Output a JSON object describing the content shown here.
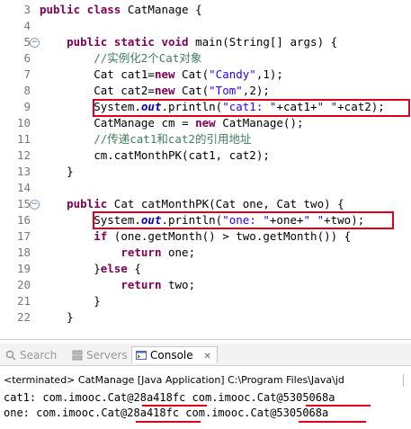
{
  "editor": {
    "lines": [
      {
        "n": "3",
        "parts": [
          [
            "kw",
            "public class "
          ],
          [
            "",
            "CatManage {"
          ]
        ]
      },
      {
        "n": "4",
        "parts": []
      },
      {
        "n": "5",
        "fold": true,
        "parts": [
          [
            "",
            "    "
          ],
          [
            "kw",
            "public static void "
          ],
          [
            "",
            "main(String[] args) {"
          ]
        ]
      },
      {
        "n": "6",
        "parts": [
          [
            "cmt",
            "        //实例化2个Cat对象"
          ]
        ]
      },
      {
        "n": "7",
        "parts": [
          [
            "",
            "        Cat cat1="
          ],
          [
            "kw",
            "new "
          ],
          [
            "",
            "Cat("
          ],
          [
            "str",
            "\"Candy\""
          ],
          [
            "",
            ",1);"
          ]
        ]
      },
      {
        "n": "8",
        "parts": [
          [
            "",
            "        Cat cat2="
          ],
          [
            "kw",
            "new "
          ],
          [
            "",
            "Cat("
          ],
          [
            "str",
            "\"Tom\""
          ],
          [
            "",
            ",2);"
          ]
        ]
      },
      {
        "n": "9",
        "parts": [
          [
            "",
            "        System."
          ],
          [
            "fld",
            "out"
          ],
          [
            "",
            ".println("
          ],
          [
            "str",
            "\"cat1: \""
          ],
          [
            "",
            "+cat1+"
          ],
          [
            "str",
            "\" \""
          ],
          [
            "",
            "+cat2);"
          ]
        ]
      },
      {
        "n": "10",
        "parts": [
          [
            "",
            "        CatManage cm = "
          ],
          [
            "kw",
            "new "
          ],
          [
            "",
            "CatManage();"
          ]
        ]
      },
      {
        "n": "11",
        "parts": [
          [
            "cmt",
            "        //传递cat1和cat2的引用地址"
          ]
        ]
      },
      {
        "n": "12",
        "parts": [
          [
            "",
            "        cm.catMonthPK(cat1, cat2);"
          ]
        ]
      },
      {
        "n": "13",
        "parts": [
          [
            "",
            "    }"
          ]
        ]
      },
      {
        "n": "14",
        "parts": []
      },
      {
        "n": "15",
        "fold": true,
        "parts": [
          [
            "",
            "    "
          ],
          [
            "kw",
            "public "
          ],
          [
            "",
            "Cat catMonthPK(Cat one, Cat two) {"
          ]
        ]
      },
      {
        "n": "16",
        "parts": [
          [
            "",
            "        System."
          ],
          [
            "fld",
            "out"
          ],
          [
            "",
            ".println("
          ],
          [
            "str",
            "\"one: \""
          ],
          [
            "",
            "+one+"
          ],
          [
            "str",
            "\" \""
          ],
          [
            "",
            "+two);"
          ]
        ]
      },
      {
        "n": "17",
        "parts": [
          [
            "",
            "        "
          ],
          [
            "kw",
            "if "
          ],
          [
            "",
            "(one.getMonth() > two.getMonth()) {"
          ]
        ]
      },
      {
        "n": "18",
        "parts": [
          [
            "",
            "            "
          ],
          [
            "kw",
            "return "
          ],
          [
            "",
            "one;"
          ]
        ]
      },
      {
        "n": "19",
        "parts": [
          [
            "",
            "        }"
          ],
          [
            "kw",
            "else "
          ],
          [
            "",
            "{"
          ]
        ]
      },
      {
        "n": "20",
        "parts": [
          [
            "",
            "            "
          ],
          [
            "kw",
            "return "
          ],
          [
            "",
            "two;"
          ]
        ]
      },
      {
        "n": "21",
        "parts": [
          [
            "",
            "        }"
          ]
        ]
      },
      {
        "n": "22",
        "parts": [
          [
            "",
            "    }"
          ]
        ]
      }
    ]
  },
  "tabs": {
    "search": "Search",
    "servers": "Servers",
    "console": "Console",
    "close": "✕"
  },
  "console": {
    "terminated": "<terminated> CatManage [Java Application] C:\\Program Files\\Java\\jd",
    "out1": "cat1: com.imooc.Cat@28a418fc com.imooc.Cat@5305068a",
    "out2": "one: com.imooc.Cat@28a418fc com.imooc.Cat@5305068a"
  },
  "colors": {
    "highlight": "#e0001b",
    "keyword": "#7f0055",
    "string": "#2a00ff",
    "comment": "#3f7f5f"
  }
}
